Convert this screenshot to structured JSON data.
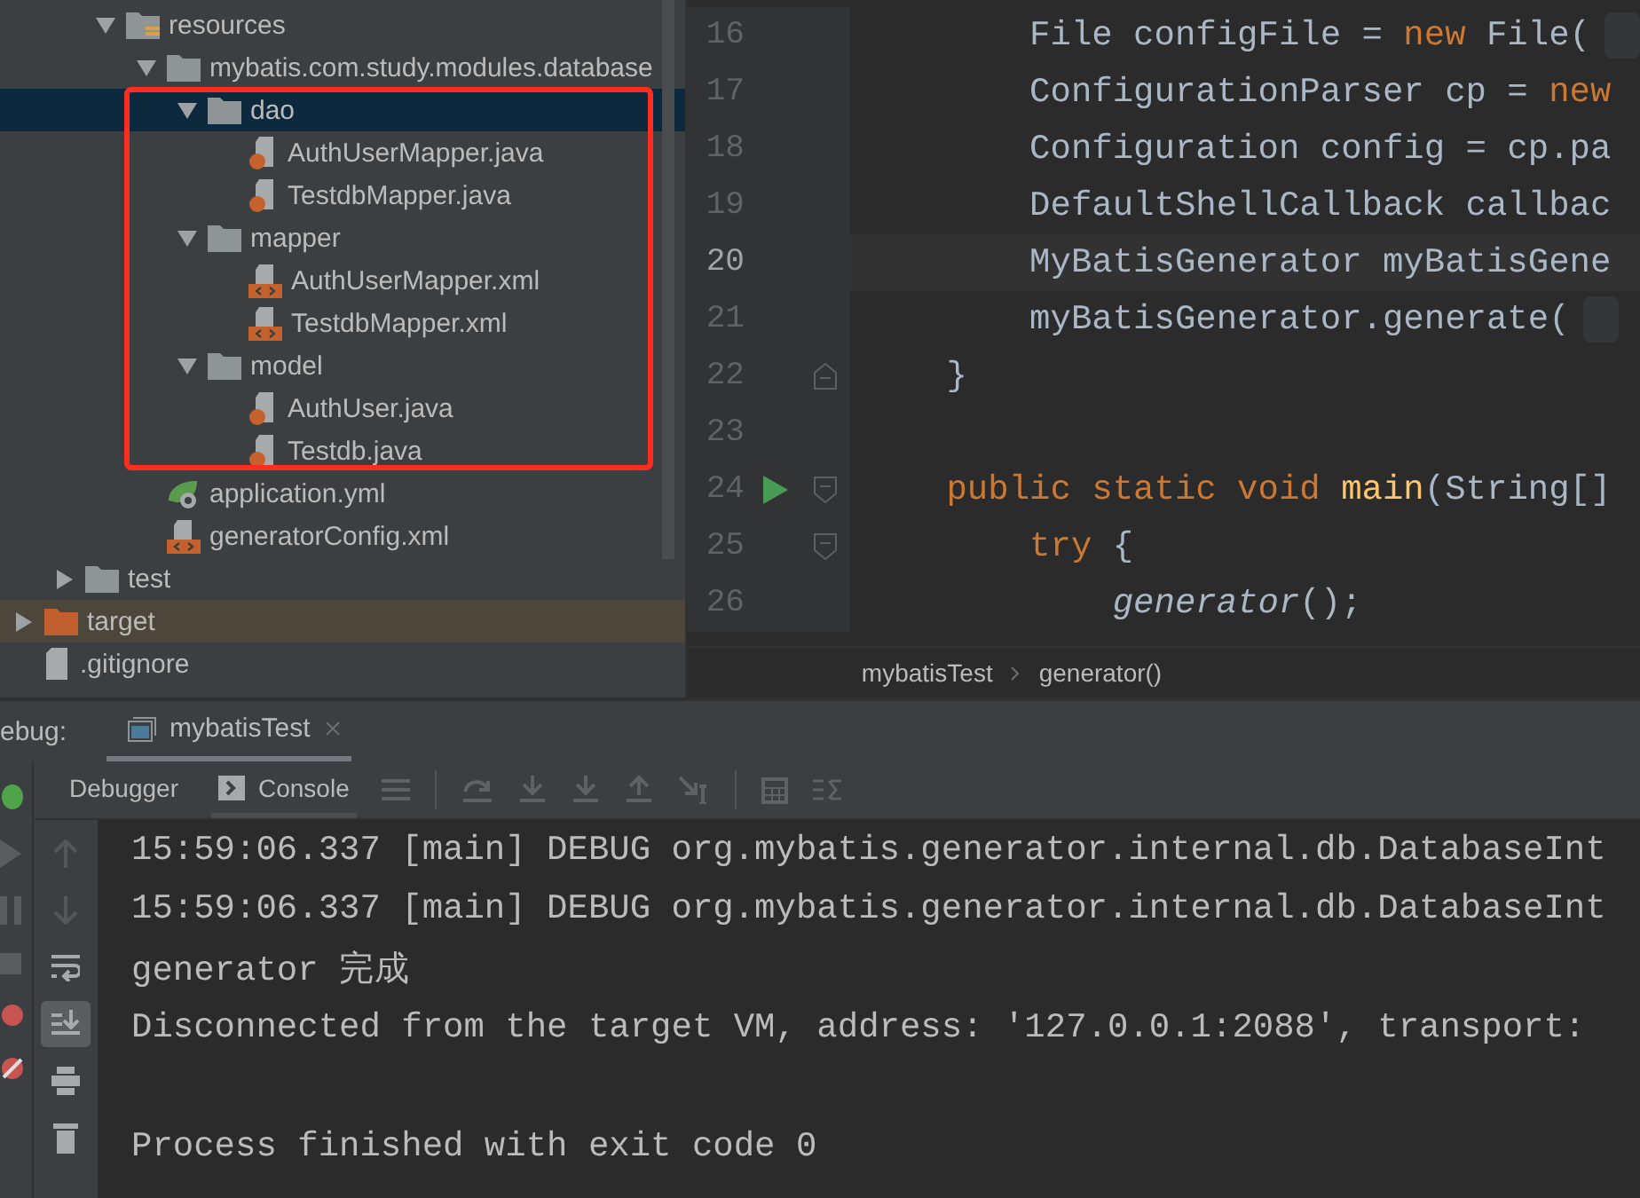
{
  "project_tree": {
    "highlight_frame": true,
    "items": [
      {
        "children": [
          {
            "children": [
              {
                "label": "resources",
                "kind": "resource-folder",
                "expanded": true,
                "selected": false,
                "children": [
                  {
                    "label": "mybatis.com.study.modules.database",
                    "kind": "package",
                    "expanded": true,
                    "selected": false,
                    "children": [
                      {
                        "label": "dao",
                        "kind": "folder",
                        "expanded": true,
                        "selected": true,
                        "children": [
                          {
                            "label": "AuthUserMapper.java",
                            "kind": "java",
                            "selected": false
                          },
                          {
                            "label": "TestdbMapper.java",
                            "kind": "java",
                            "selected": false
                          }
                        ]
                      },
                      {
                        "label": "mapper",
                        "kind": "folder",
                        "expanded": true,
                        "selected": false,
                        "children": [
                          {
                            "label": "AuthUserMapper.xml",
                            "kind": "xml",
                            "selected": false
                          },
                          {
                            "label": "TestdbMapper.xml",
                            "kind": "xml",
                            "selected": false
                          }
                        ]
                      },
                      {
                        "label": "model",
                        "kind": "folder",
                        "expanded": true,
                        "selected": false,
                        "children": [
                          {
                            "label": "AuthUser.java",
                            "kind": "java",
                            "selected": false
                          },
                          {
                            "label": "Testdb.java",
                            "kind": "java",
                            "selected": false
                          }
                        ]
                      }
                    ]
                  },
                  {
                    "label": "application.yml",
                    "kind": "yml",
                    "selected": false
                  },
                  {
                    "label": "generatorConfig.xml",
                    "kind": "xml",
                    "selected": false
                  }
                ]
              }
            ]
          },
          {
            "label": "test",
            "kind": "folder",
            "expanded": false,
            "selected": false
          }
        ]
      },
      {
        "label": "target",
        "kind": "excluded-folder",
        "expanded": false,
        "selected": false
      },
      {
        "label": ".gitignore",
        "kind": "file",
        "selected": false
      }
    ]
  },
  "editor": {
    "lines": [
      {
        "number": "16",
        "kind": "code",
        "current": false,
        "run": false,
        "hint": true,
        "tokens": [
          {
            "text": "        File configFile = ",
            "kind": "plain"
          },
          {
            "text": "new",
            "kind": "keyword"
          },
          {
            "text": " File(",
            "kind": "plain"
          }
        ]
      },
      {
        "number": "17",
        "kind": "code",
        "current": false,
        "run": false,
        "hint": false,
        "tokens": [
          {
            "text": "        ConfigurationParser cp = ",
            "kind": "plain"
          },
          {
            "text": "new",
            "kind": "keyword"
          }
        ]
      },
      {
        "number": "18",
        "kind": "code",
        "current": false,
        "run": false,
        "hint": false,
        "tokens": [
          {
            "text": "        Configuration config = cp.pa",
            "kind": "plain"
          }
        ]
      },
      {
        "number": "19",
        "kind": "code",
        "current": false,
        "run": false,
        "hint": false,
        "tokens": [
          {
            "text": "        DefaultShellCallback callbac",
            "kind": "plain"
          }
        ]
      },
      {
        "number": "20",
        "kind": "code",
        "current": true,
        "run": false,
        "hint": false,
        "tokens": [
          {
            "text": "        MyBatisGenerator myBatisGene",
            "kind": "plain"
          }
        ]
      },
      {
        "number": "21",
        "kind": "code",
        "current": false,
        "run": false,
        "hint": true,
        "tokens": [
          {
            "text": "        myBatisGenerator.generate(",
            "kind": "plain"
          }
        ]
      },
      {
        "number": "22",
        "kind": "fold-end",
        "current": false,
        "run": false,
        "hint": false,
        "tokens": [
          {
            "text": "    }",
            "kind": "plain"
          }
        ]
      },
      {
        "number": "23",
        "kind": "code",
        "current": false,
        "run": false,
        "hint": false
      },
      {
        "number": "24",
        "kind": "fold-start",
        "current": false,
        "run": true,
        "hint": false,
        "tokens": [
          {
            "text": "    public static void ",
            "kind": "keyword"
          },
          {
            "text": "main",
            "kind": "method"
          },
          {
            "text": "(String[]",
            "kind": "plain"
          }
        ]
      },
      {
        "number": "25",
        "kind": "fold-start",
        "current": false,
        "run": false,
        "hint": false,
        "tokens": [
          {
            "text": "        try",
            "kind": "keyword"
          },
          {
            "text": " {",
            "kind": "plain"
          }
        ]
      },
      {
        "number": "26",
        "kind": "code",
        "current": false,
        "run": false,
        "hint": false,
        "tokens": [
          {
            "text": "            generator",
            "kind": "italic"
          },
          {
            "text": "();",
            "kind": "plain"
          }
        ]
      }
    ],
    "breadcrumbs": [
      "mybatisTest",
      "generator()"
    ]
  },
  "debug": {
    "title": "ebug:",
    "tabs": [
      {
        "label": "mybatisTest",
        "selected": true
      }
    ],
    "subtabs": [
      {
        "label": "Debugger",
        "kind": "debugger",
        "selected": false
      },
      {
        "label": "Console",
        "kind": "console",
        "selected": true
      }
    ],
    "console_tools": [
      {
        "kind": "up",
        "on": false
      },
      {
        "kind": "down",
        "on": false
      },
      {
        "kind": "wrap",
        "on": false
      },
      {
        "kind": "scroll-end",
        "on": true
      },
      {
        "kind": "print",
        "on": false
      },
      {
        "kind": "trash",
        "on": false
      }
    ],
    "console": [
      {
        "kind": "text",
        "text": "15:59:06.337 [main] DEBUG org.mybatis.generator.internal.db.DatabaseInt"
      },
      {
        "kind": "text",
        "text": "15:59:06.337 [main] DEBUG org.mybatis.generator.internal.db.DatabaseInt"
      },
      {
        "kind": "text",
        "text": "generator 完成"
      },
      {
        "kind": "text",
        "text": "Disconnected from the target VM, address: '127.0.0.1:2088', transport:"
      },
      {
        "kind": "blank"
      },
      {
        "kind": "text",
        "text": "Process finished with exit code 0"
      }
    ]
  }
}
